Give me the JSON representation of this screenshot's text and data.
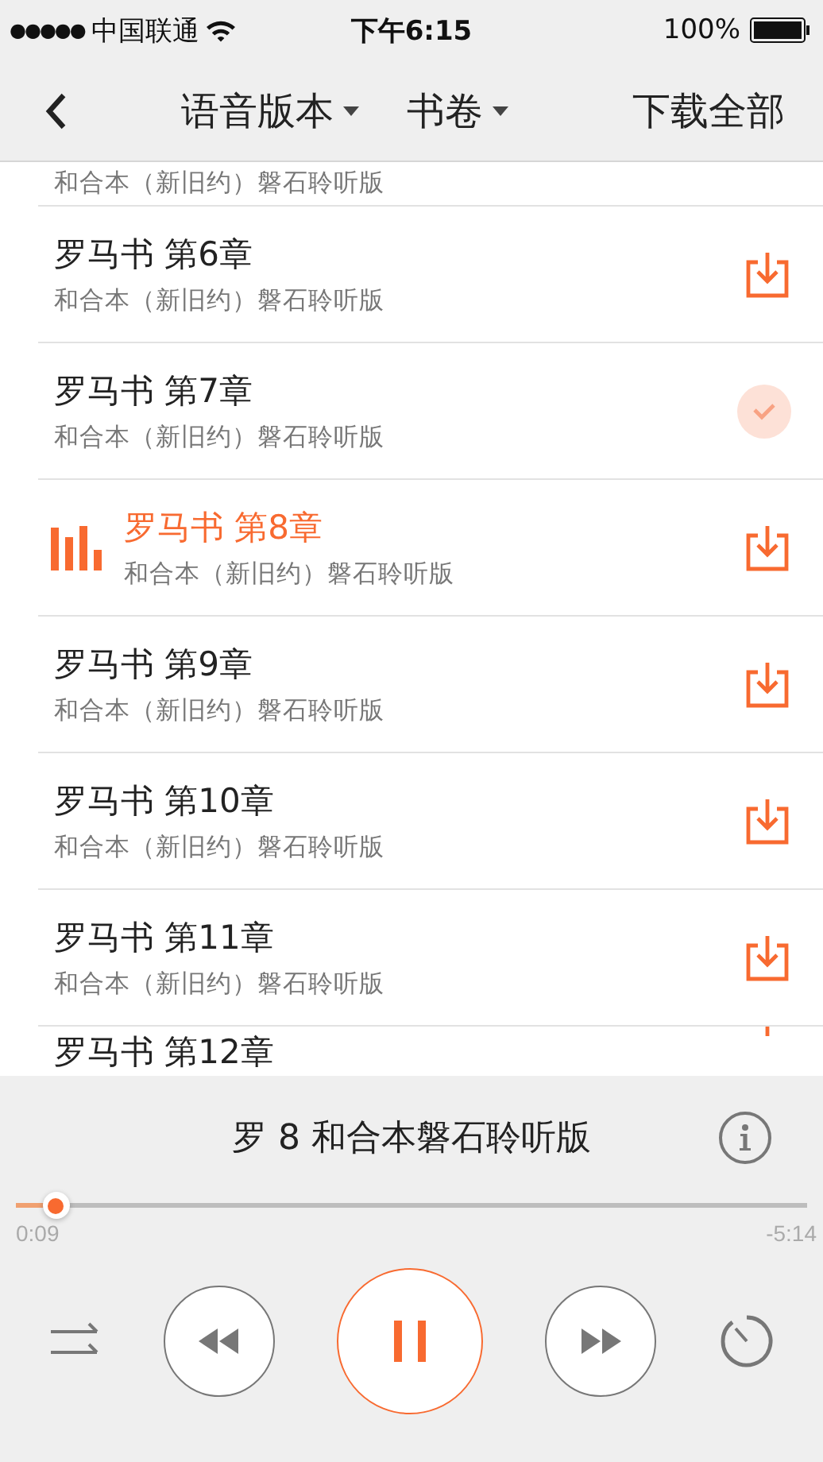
{
  "status_bar": {
    "signal_dots": "●●●●●",
    "carrier": "中国联通",
    "time": "下午6:15",
    "battery": "100%"
  },
  "nav": {
    "menus": [
      {
        "label": "语音版本"
      },
      {
        "label": "书卷"
      }
    ],
    "action": "下载全部"
  },
  "chapters": [
    {
      "subtitle": "和合本（新旧约）磐石聆听版"
    },
    {
      "title": "罗马书 第6章",
      "subtitle": "和合本（新旧约）磐石聆听版",
      "playing": false,
      "downloaded": false
    },
    {
      "title": "罗马书 第7章",
      "subtitle": "和合本（新旧约）磐石聆听版",
      "playing": false,
      "downloaded": true
    },
    {
      "title": "罗马书 第8章",
      "subtitle": "和合本（新旧约）磐石聆听版",
      "playing": true,
      "downloaded": false
    },
    {
      "title": "罗马书 第9章",
      "subtitle": "和合本（新旧约）磐石聆听版",
      "playing": false,
      "downloaded": false
    },
    {
      "title": "罗马书 第10章",
      "subtitle": "和合本（新旧约）磐石聆听版",
      "playing": false,
      "downloaded": false
    },
    {
      "title": "罗马书 第11章",
      "subtitle": "和合本（新旧约）磐石聆听版",
      "playing": false,
      "downloaded": false
    },
    {
      "title": "罗马书 第12章",
      "playing": false,
      "downloaded": false
    }
  ],
  "player": {
    "title": "罗 8 和合本磐石聆听版",
    "level": 0.05,
    "elapsed": "0:09",
    "remaining": "-5:14",
    "playing": true
  }
}
